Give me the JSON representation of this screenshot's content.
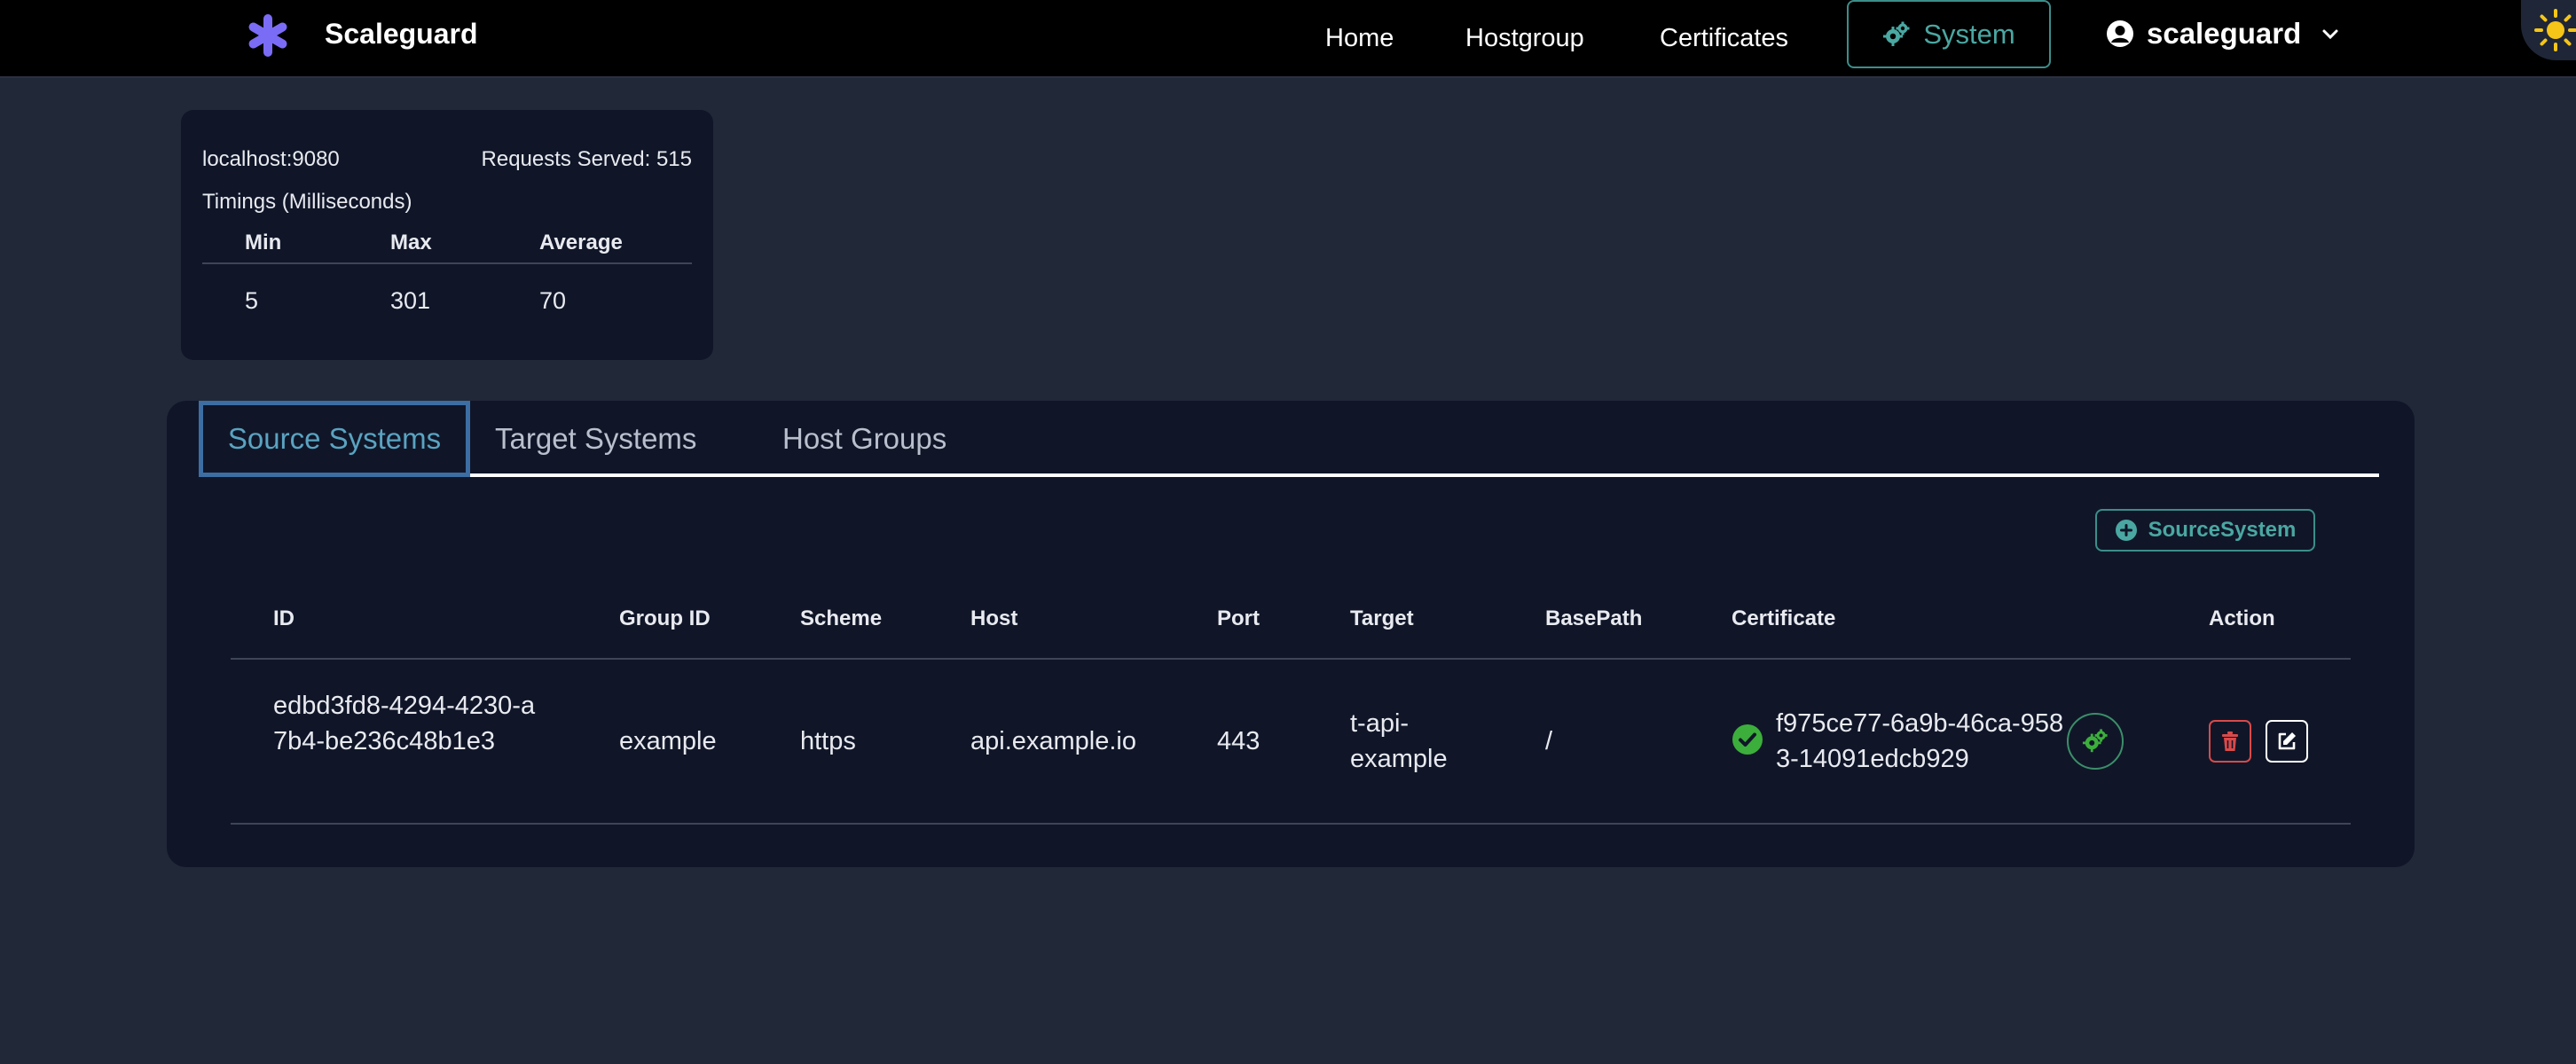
{
  "app": {
    "name": "Scaleguard",
    "logo_icon": "asterisk-logo-icon",
    "accent": "#7b6cf6"
  },
  "nav": {
    "home": "Home",
    "hostgroup": "Hostgroup",
    "certificates": "Certificates",
    "system": "System",
    "system_icon": "gears-icon",
    "user": "scaleguard",
    "theme_icon": "sun-icon"
  },
  "stats": {
    "host": "localhost:9080",
    "requests_served": "Requests Served: 515",
    "timings_label": "Timings (Milliseconds)",
    "columns": {
      "min": "Min",
      "max": "Max",
      "average": "Average"
    },
    "values": {
      "min": "5",
      "max": "301",
      "average": "70"
    }
  },
  "tabs": [
    {
      "label": "Source Systems",
      "active": true
    },
    {
      "label": "Target Systems",
      "active": false
    },
    {
      "label": "Host Groups",
      "active": false
    }
  ],
  "add_button": {
    "label": "SourceSystem",
    "icon": "plus-circle-icon"
  },
  "table": {
    "columns": {
      "id": "ID",
      "group_id": "Group ID",
      "scheme": "Scheme",
      "host": "Host",
      "port": "Port",
      "target": "Target",
      "basepath": "BasePath",
      "certificate": "Certificate",
      "action": "Action"
    },
    "rows": [
      {
        "id": "edbd3fd8-4294-4230-a7b4-be236c48b1e3",
        "group_id": "example",
        "scheme": "https",
        "host": "api.example.io",
        "port": "443",
        "target": "t-api-example",
        "basepath": "/",
        "certificate": "f975ce77-6a9b-46ca-9583-14091edcb929",
        "certificate_status_icon": "check-circle-icon"
      }
    ]
  },
  "colors": {
    "background": "#212838",
    "panel": "#101628",
    "teal": "#4aa7a2",
    "danger": "#d94a4a",
    "success": "#3cae3c"
  }
}
